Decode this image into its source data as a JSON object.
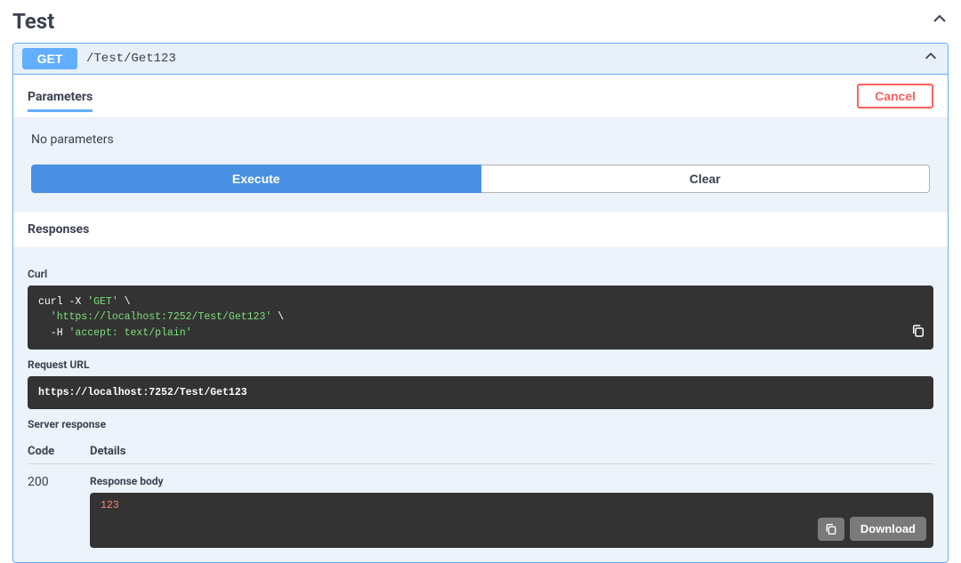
{
  "section": {
    "title": "Test"
  },
  "endpoint": {
    "method": "GET",
    "path": "/Test/Get123"
  },
  "parameters": {
    "label": "Parameters",
    "cancel": "Cancel",
    "none": "No parameters"
  },
  "actions": {
    "execute": "Execute",
    "clear": "Clear"
  },
  "responses": {
    "label": "Responses"
  },
  "curl": {
    "label": "Curl",
    "line1_cmd": "curl",
    "line1_flag": " -X ",
    "line1_method": "'GET'",
    "line1_cont": " \\",
    "line2": "  'https://localhost:7252/Test/Get123'",
    "line2_cont": " \\",
    "line3_flag": "  -H ",
    "line3_val": "'accept: text/plain'"
  },
  "requestUrl": {
    "label": "Request URL",
    "value": "https://localhost:7252/Test/Get123"
  },
  "serverResponse": {
    "label": "Server response",
    "codeHeader": "Code",
    "detailsHeader": "Details",
    "statusCode": "200",
    "responseBodyLabel": "Response body",
    "responseBody": "123",
    "download": "Download"
  }
}
